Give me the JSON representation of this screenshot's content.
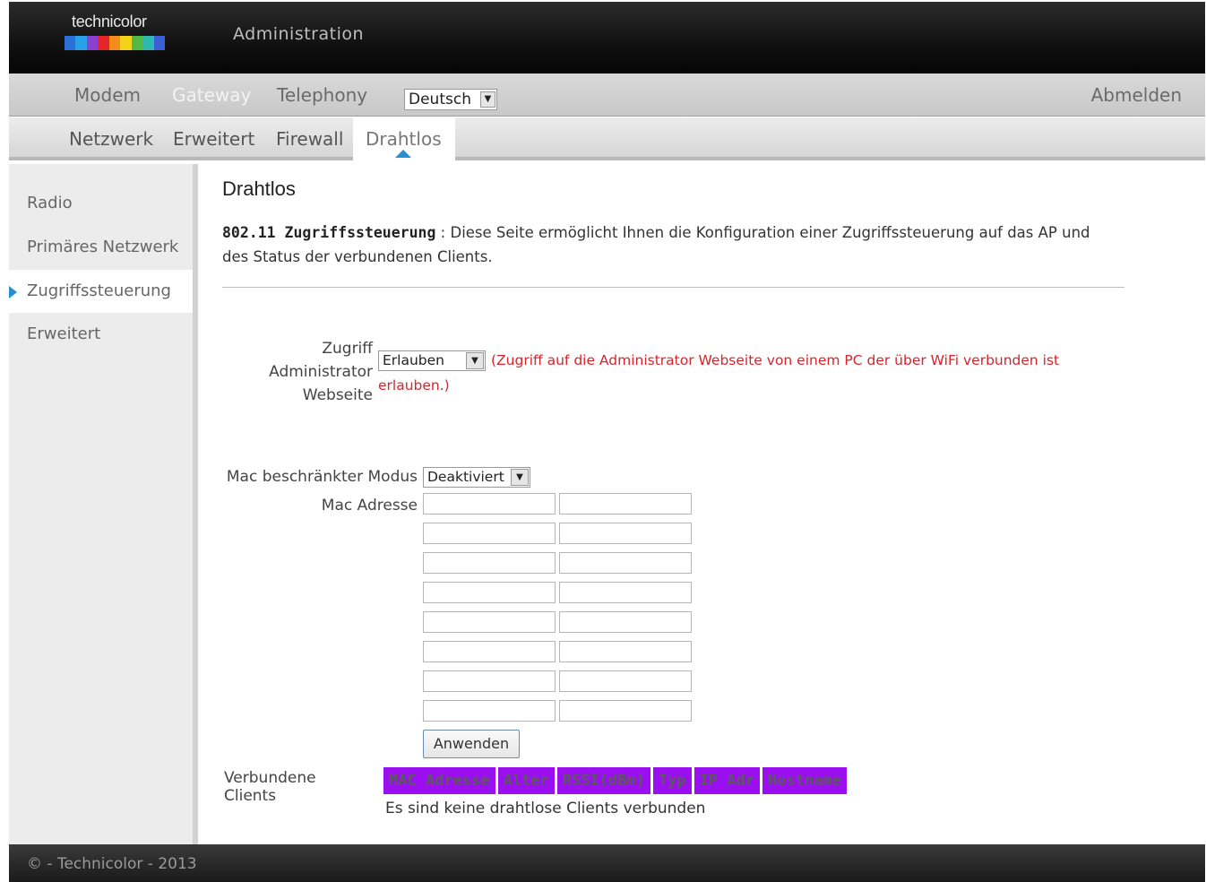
{
  "header": {
    "logo_text": "technicolor",
    "title": "Administration",
    "logo_colors": [
      "#2b6fd6",
      "#2aa0e8",
      "#8a3fd0",
      "#e8242b",
      "#f28c1a",
      "#f5d21a",
      "#52b848",
      "#2fb8b0",
      "#3b5fd6"
    ]
  },
  "main_nav": {
    "items": [
      "Modem",
      "Gateway",
      "Telephony"
    ],
    "active": "Gateway",
    "language": "Deutsch",
    "logout": "Abmelden"
  },
  "sub_nav": {
    "items": [
      "Netzwerk",
      "Erweitert",
      "Firewall",
      "Drahtlos"
    ],
    "active": "Drahtlos"
  },
  "sidebar": {
    "items": [
      "Radio",
      "Primäres Netzwerk",
      "Zugriffssteuerung",
      "Erweitert"
    ],
    "active": "Zugriffssteuerung"
  },
  "content": {
    "title": "Drahtlos",
    "desc_bold": "802.11 Zugriffssteuerung",
    "desc_sep": ":",
    "desc_text": "Diese Seite ermöglicht Ihnen die Konfiguration einer Zugriffssteuerung auf das AP und des Status der verbundenen Clients.",
    "access_label_line1": "Zugriff",
    "access_label_line2": "Administrator",
    "access_label_line3": "Webseite",
    "access_value": "Erlauben",
    "access_note": "(Zugriff auf die Administrator Webseite von einem PC der über WiFi verbunden ist erlauben.)",
    "mac_mode_label": "Mac beschränkter Modus",
    "mac_mode_value": "Deaktiviert",
    "mac_address_label": "Mac Adresse",
    "apply_button": "Anwenden",
    "clients_label": "Verbundene Clients",
    "clients_columns": [
      "MAC Adresse",
      "Alter",
      "RSSI(dBm)",
      "Typ",
      "IP Adr",
      "Hostname"
    ],
    "no_clients": "Es sind keine drahtlose Clients verbunden"
  },
  "footer": {
    "text": "© - Technicolor - 2013"
  }
}
